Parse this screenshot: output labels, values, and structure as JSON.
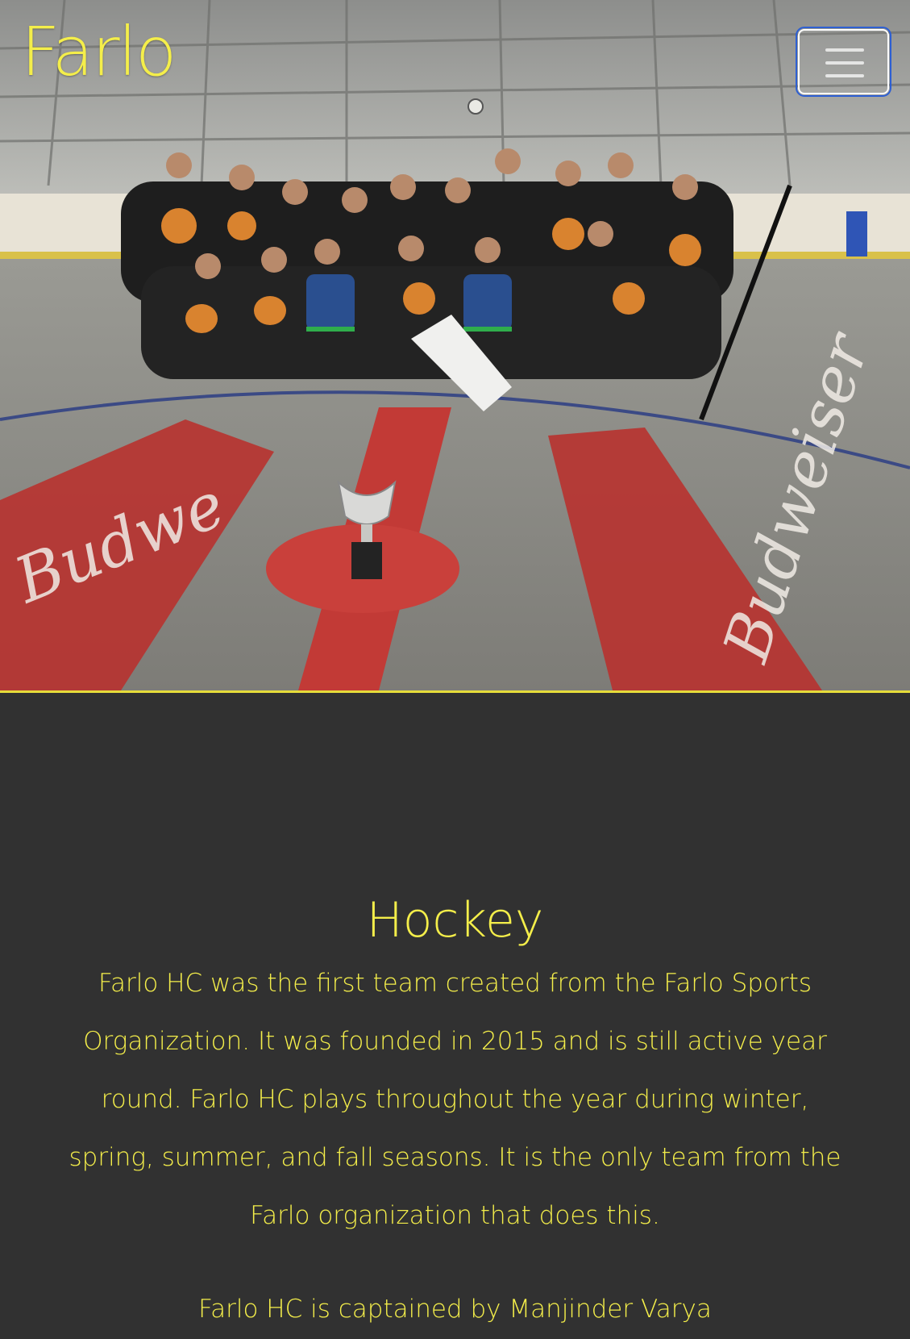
{
  "navbar": {
    "brand": "Farlo",
    "menu_icon": "hamburger-menu-icon"
  },
  "hero": {
    "image_subject": "team-photo",
    "floor_text_left": "Budwe",
    "floor_text_right": "Budweiser"
  },
  "section": {
    "title": "Hockey",
    "description": "Farlo HC was the first team created from the Farlo Sports Organization. It was founded in 2015 and is still active year round. Farlo HC plays throughout the year during winter, spring, summer, and fall seasons. It is the only team from the Farlo organization that does this.",
    "captain": "Farlo HC is captained by Manjinder Varya"
  },
  "colors": {
    "accent_yellow": "#f4ee4a",
    "background": "#313131",
    "focus_ring": "#2d5fd3"
  }
}
